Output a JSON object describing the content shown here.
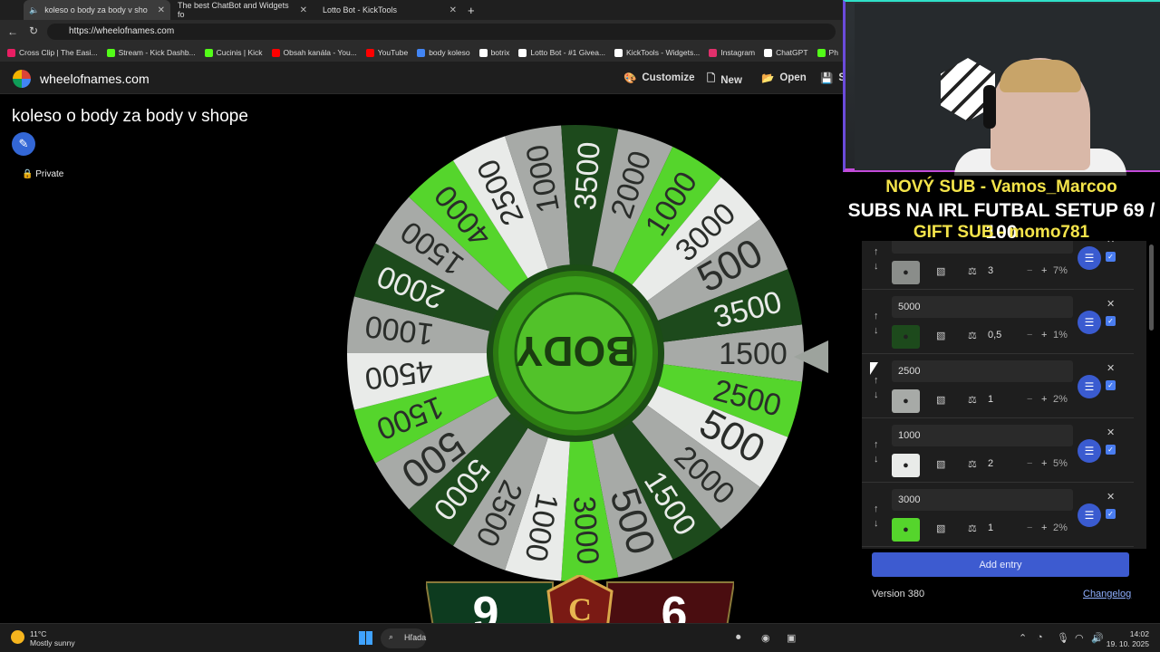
{
  "browser": {
    "tabs": [
      {
        "label": "koleso o body za body v sho",
        "active": true
      },
      {
        "label": "The best ChatBot and Widgets fo",
        "active": false
      },
      {
        "label": "Lotto Bot - KickTools",
        "active": false
      }
    ],
    "url": "https://wheelofnames.com",
    "bookmarks": [
      {
        "label": "Cross Clip | The Easi...",
        "color": "#e91e63"
      },
      {
        "label": "Stream - Kick Dashb...",
        "color": "#53fc18"
      },
      {
        "label": "Cucinis | Kick",
        "color": "#53fc18"
      },
      {
        "label": "Obsah kanála - You...",
        "color": "#ff0000"
      },
      {
        "label": "YouTube",
        "color": "#ff0000"
      },
      {
        "label": "body koleso",
        "color": "#4285f4"
      },
      {
        "label": "botrix",
        "color": "#ffffff"
      },
      {
        "label": "Lotto Bot - #1 Givea...",
        "color": "#ffffff"
      },
      {
        "label": "KickTools - Widgets...",
        "color": "#ffffff"
      },
      {
        "label": "Instagram",
        "color": "#e1306c"
      },
      {
        "label": "ChatGPT",
        "color": "#ffffff"
      },
      {
        "label": "Ph",
        "color": "#53fc18"
      }
    ]
  },
  "site": {
    "name": "wheelofnames.com",
    "nav": {
      "customize": "Customize",
      "new": "New",
      "open": "Open",
      "save": "S"
    },
    "title": "koleso o body za body v shope",
    "private_label": "Private"
  },
  "wheel": {
    "center_label": "BODY",
    "colors": {
      "green": "#55d52c",
      "gray": "#a7aaa7",
      "white": "#e9ebe9",
      "dark": "#1d4a1c"
    },
    "segments": [
      {
        "label": "1500",
        "color": "gray"
      },
      {
        "label": "2500",
        "color": "green"
      },
      {
        "label": "500",
        "color": "white"
      },
      {
        "label": "2000",
        "color": "gray"
      },
      {
        "label": "1500",
        "color": "dark"
      },
      {
        "label": "500",
        "color": "gray"
      },
      {
        "label": "3000",
        "color": "green"
      },
      {
        "label": "1000",
        "color": "white"
      },
      {
        "label": "2500",
        "color": "gray"
      },
      {
        "label": "5000",
        "color": "dark"
      },
      {
        "label": "500",
        "color": "gray"
      },
      {
        "label": "1500",
        "color": "green"
      },
      {
        "label": "4500",
        "color": "white"
      },
      {
        "label": "1000",
        "color": "gray"
      },
      {
        "label": "2000",
        "color": "dark"
      },
      {
        "label": "1500",
        "color": "gray"
      },
      {
        "label": "4000",
        "color": "green"
      },
      {
        "label": "2500",
        "color": "white"
      },
      {
        "label": "1000",
        "color": "gray"
      },
      {
        "label": "3500",
        "color": "dark"
      },
      {
        "label": "2000",
        "color": "gray"
      },
      {
        "label": "1000",
        "color": "green"
      },
      {
        "label": "3000",
        "color": "white"
      },
      {
        "label": "500",
        "color": "gray"
      },
      {
        "label": "3500",
        "color": "dark"
      }
    ]
  },
  "overlay": {
    "alert_sub": "NOVÝ SUB - Vamos_Marcoo",
    "goal": "SUBS NA IRL FUTBAL SETUP   69 / 100",
    "alert_gift": "GIFT SUB - momo781"
  },
  "entries": [
    {
      "text": "",
      "weight": "3",
      "percent": "7%",
      "color": "#8a8d8a"
    },
    {
      "text": "5000",
      "weight": "0,5",
      "percent": "1%",
      "color": "#1d4a1c"
    },
    {
      "text": "2500",
      "weight": "1",
      "percent": "2%",
      "color": "#a7aaa7"
    },
    {
      "text": "1000",
      "weight": "2",
      "percent": "5%",
      "color": "#e9ebe9"
    },
    {
      "text": "3000",
      "weight": "1",
      "percent": "2%",
      "color": "#55d52c"
    }
  ],
  "panel": {
    "add_entry": "Add entry",
    "version": "Version 380",
    "changelog": "Changelog"
  },
  "scoreboard": {
    "left": "9",
    "right": "6",
    "emblem": "C"
  },
  "taskbar": {
    "temp": "11°C",
    "weather": "Mostly sunny",
    "search": "Hľada",
    "time": "14:02",
    "date": "19. 10. 2025"
  }
}
